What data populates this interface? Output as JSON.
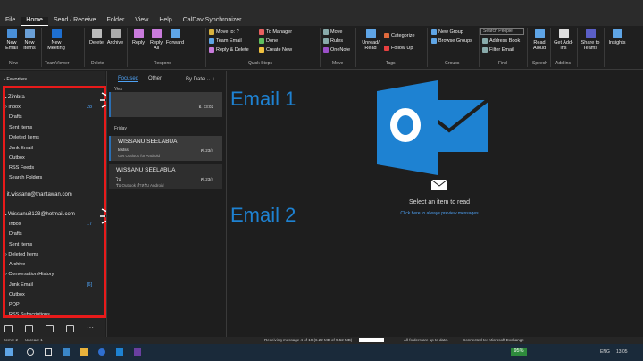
{
  "tabs": [
    "File",
    "Home",
    "Send / Receive",
    "Folder",
    "View",
    "Help",
    "CalDav Synchronizer"
  ],
  "active_tab": "Home",
  "ribbon": {
    "new_email": "New Email",
    "new_items": "New Items",
    "new_meeting": "New Meeting",
    "teamviewer_group": "TeamViewer",
    "delete": "Delete",
    "archive": "Archive",
    "reply": "Reply",
    "reply_all": "Reply All",
    "forward": "Forward",
    "move_to": "Move to: ?",
    "team_email": "Team Email",
    "reply_delete": "Reply & Delete",
    "to_manager": "To Manager",
    "done": "Done",
    "create_new": "Create New",
    "move": "Move",
    "rules": "Rules",
    "onenote": "OneNote",
    "unread_read": "Unread/ Read",
    "categorize": "Categorize",
    "follow_up": "Follow Up",
    "new_group": "New Group",
    "browse_groups": "Browse Groups",
    "search_people_placeholder": "Search People",
    "address_book": "Address Book",
    "filter_email": "Filter Email",
    "read_aloud": "Read Aloud",
    "get_addins": "Get Add-ins",
    "share_to_teams": "Share to Teams",
    "insights": "Insights",
    "groups_labels": [
      "New",
      "TeamViewer",
      "Delete",
      "Respond",
      "Quick Steps",
      "Move",
      "Tags",
      "Groups",
      "Find",
      "Speech",
      "Add-ins",
      ""
    ]
  },
  "nav": {
    "favorites": "Favorites",
    "account1": "Zimbra",
    "account1_folders": [
      {
        "name": "Inbox",
        "count": "28"
      },
      {
        "name": "Drafts",
        "count": ""
      },
      {
        "name": "Sent Items",
        "count": ""
      },
      {
        "name": "Deleted Items",
        "count": ""
      },
      {
        "name": "Junk Email",
        "count": ""
      },
      {
        "name": "Outbox",
        "count": ""
      },
      {
        "name": "RSS Feeds",
        "count": ""
      },
      {
        "name": "Search Folders",
        "count": ""
      }
    ],
    "account2": "it.wissanu@thantawan.com",
    "account3": "Wissanu8123@hotmail.com",
    "account3_folders": [
      {
        "name": "Inbox",
        "count": "17"
      },
      {
        "name": "Drafts",
        "count": ""
      },
      {
        "name": "Sent Items",
        "count": ""
      },
      {
        "name": "Deleted Items",
        "count": ""
      },
      {
        "name": "Archive",
        "count": ""
      },
      {
        "name": "Conversation History",
        "count": ""
      },
      {
        "name": "Junk Email",
        "count": "[6]"
      },
      {
        "name": "Outbox",
        "count": ""
      },
      {
        "name": "POP",
        "count": ""
      },
      {
        "name": "RSS Subscriptions",
        "count": ""
      }
    ]
  },
  "list": {
    "focused": "Focused",
    "other": "Other",
    "sort": "By Date",
    "group_yesterday": "Yes",
    "group_friday": "Friday",
    "messages": [
      {
        "from": "",
        "subject": "",
        "date": "อ. 13:02",
        "preview": ""
      },
      {
        "from": "WISSANU SEELABUA",
        "subject": "testss",
        "date": "ศ. 23/4",
        "preview": "Get Outlook for Android"
      },
      {
        "from": "WISSANU SEELABUA",
        "subject": "ไป",
        "date": "ศ. 23/4",
        "preview": "รับ Outlook สำหรับ Android"
      }
    ]
  },
  "reading": {
    "select_text": "Select an item to read",
    "preview_link": "Click here to always preview messages"
  },
  "annotations": {
    "email1": "Email 1",
    "email2": "Email 2"
  },
  "status": {
    "items": "Items: 2",
    "unread": "Unread: 1",
    "receiving": "Receiving message 4 of 19 (6.22 MB of 9.52 MB)",
    "uptodate": "All folders are up to date.",
    "connected": "Connected to: Microsoft Exchange"
  },
  "taskbar": {
    "battery": "95%",
    "lang": "ENG",
    "time": "13:05"
  },
  "colors": {
    "accent": "#1e82d2",
    "highlight": "#e81a1a",
    "arrow": "#f4c21b"
  }
}
